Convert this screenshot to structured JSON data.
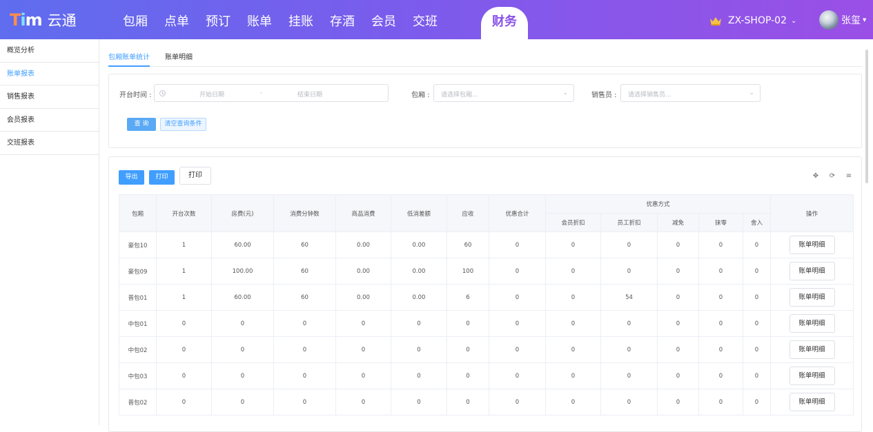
{
  "app": {
    "logo_text": "云通",
    "nav": [
      "包厢",
      "点单",
      "预订",
      "账单",
      "挂账",
      "存酒",
      "会员",
      "交班"
    ],
    "nav_active": "财务",
    "shop": "ZX-SHOP-02",
    "user": "张玺"
  },
  "sidebar": {
    "items": [
      {
        "label": "概览分析"
      },
      {
        "label": "账单报表"
      },
      {
        "label": "销售报表"
      },
      {
        "label": "会员报表"
      },
      {
        "label": "交班报表"
      }
    ]
  },
  "tabs": [
    "包厢账单统计",
    "账单明细"
  ],
  "filter": {
    "open_time_label": "开台时间 :",
    "start_placeholder": "开始日期",
    "separator": "-",
    "end_placeholder": "结束日期",
    "room_label": "包厢 :",
    "room_placeholder": "请选择包厢...",
    "seller_label": "销售员 :",
    "seller_placeholder": "请选择销售员...",
    "query_btn": "查 询",
    "clear_btn": "清空查询条件"
  },
  "toolbar": {
    "export_btn": "导出",
    "print_btn": "打印",
    "print_btn2": "打印"
  },
  "table": {
    "headers": [
      "包厢",
      "开台次数",
      "房费(元)",
      "消费分钟数",
      "商品消费",
      "低消差额",
      "应收",
      "优惠合计"
    ],
    "discount_group": "优惠方式",
    "discount_headers": [
      "会员折扣",
      "员工折扣",
      "减免",
      "抹零",
      "舍入"
    ],
    "action_header": "操作",
    "action_btn": "账单明细",
    "rows": [
      [
        "豪包10",
        "1",
        "60.00",
        "60",
        "0.00",
        "0.00",
        "60",
        "0",
        "0",
        "0",
        "0",
        "0",
        "0"
      ],
      [
        "豪包09",
        "1",
        "100.00",
        "60",
        "0.00",
        "0.00",
        "100",
        "0",
        "0",
        "0",
        "0",
        "0",
        "0"
      ],
      [
        "普包01",
        "1",
        "60.00",
        "60",
        "0.00",
        "0.00",
        "6",
        "0",
        "0",
        "54",
        "0",
        "0",
        "0"
      ],
      [
        "中包01",
        "0",
        "0",
        "0",
        "0",
        "0",
        "0",
        "0",
        "0",
        "0",
        "0",
        "0",
        "0"
      ],
      [
        "中包02",
        "0",
        "0",
        "0",
        "0",
        "0",
        "0",
        "0",
        "0",
        "0",
        "0",
        "0",
        "0"
      ],
      [
        "中包03",
        "0",
        "0",
        "0",
        "0",
        "0",
        "0",
        "0",
        "0",
        "0",
        "0",
        "0",
        "0"
      ],
      [
        "普包02",
        "0",
        "0",
        "0",
        "0",
        "0",
        "0",
        "0",
        "0",
        "0",
        "0",
        "0",
        "0"
      ]
    ]
  },
  "colors": {
    "primary": "#409eff",
    "header_gradient_start": "#5f6dee",
    "header_gradient_end": "#9a4fe6",
    "active_nav_text": "#8a52e8"
  },
  "icons": [
    "crown-icon",
    "chevron-down-icon",
    "clock-icon",
    "move-icon",
    "refresh-icon",
    "settings-icon"
  ]
}
